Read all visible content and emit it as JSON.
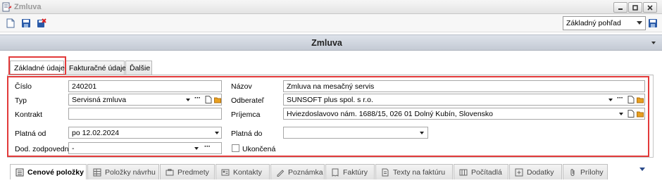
{
  "window": {
    "title": "Zmluva"
  },
  "toolbar": {
    "view_select": "Základný pohľad"
  },
  "header": {
    "title": "Zmluva"
  },
  "tabs": [
    {
      "label": "Základné údaje",
      "active": true
    },
    {
      "label": "Fakturačné údaje",
      "active": false
    },
    {
      "label": "Ďalšie",
      "active": false
    }
  ],
  "form": {
    "cislo": {
      "label": "Číslo",
      "value": "240201"
    },
    "typ": {
      "label": "Typ",
      "value": "Servisná zmluva"
    },
    "kontrakt": {
      "label": "Kontrakt",
      "value": ""
    },
    "platna_od": {
      "label": "Platná od",
      "value": "po 12.02.2024"
    },
    "dod_zodpovedny": {
      "label": "Dod. zodpovedný",
      "value": "-"
    },
    "nazov": {
      "label": "Názov",
      "value": "Zmluva na mesačný servis"
    },
    "odberatel": {
      "label": "Odberateľ",
      "value": "SUNSOFT plus spol. s r.o."
    },
    "prijemca": {
      "label": "Príjemca",
      "value": "Hviezdoslavovo nám. 1688/15, 026 01 Dolný Kubín, Slovensko"
    },
    "platna_do": {
      "label": "Platná do",
      "value": ""
    },
    "ukoncena": {
      "label": "Ukončená",
      "checked": false
    },
    "dots": "···"
  },
  "bottom_tabs": [
    {
      "label": "Cenové položky",
      "icon": "list-icon",
      "active": true
    },
    {
      "label": "Položky návrhu",
      "icon": "table-icon",
      "active": false
    },
    {
      "label": "Predmety",
      "icon": "tools-icon",
      "active": false
    },
    {
      "label": "Kontakty",
      "icon": "contact-card-icon",
      "active": false
    },
    {
      "label": "Poznámka",
      "icon": "note-icon",
      "active": false
    },
    {
      "label": "Faktúry",
      "icon": "invoice-icon",
      "active": false
    },
    {
      "label": "Texty na faktúru",
      "icon": "text-doc-icon",
      "active": false
    },
    {
      "label": "Počítadlá",
      "icon": "counter-icon",
      "active": false
    },
    {
      "label": "Dodatky",
      "icon": "amendment-icon",
      "active": false
    },
    {
      "label": "Prílohy",
      "icon": "paperclip-icon",
      "active": false
    }
  ],
  "colors": {
    "highlight": "#e23a3a",
    "header_band": "#c9ced8",
    "folder": "#e8a020"
  }
}
